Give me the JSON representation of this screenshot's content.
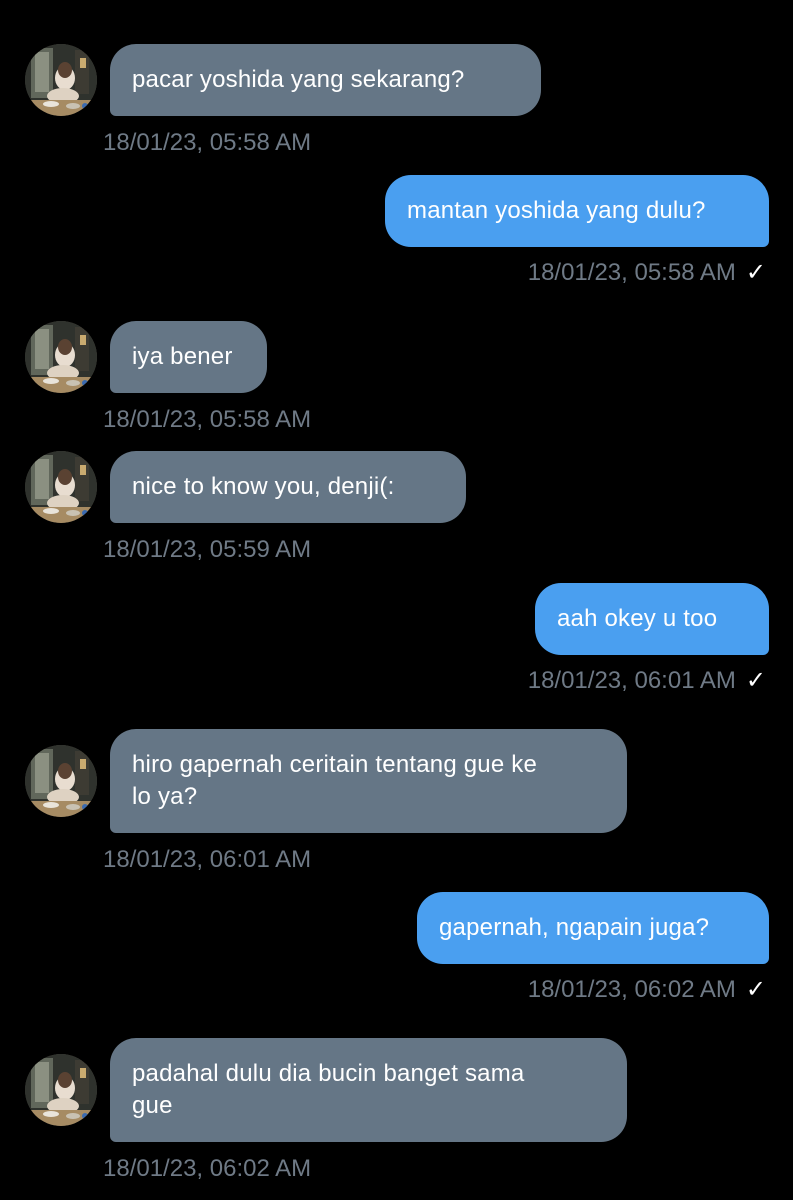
{
  "messages": [
    {
      "side": "in",
      "text": "pacar yoshida yang sekarang?",
      "time": "18/01/23, 05:58 AM"
    },
    {
      "side": "out",
      "text": "mantan yoshida yang dulu?",
      "time": "18/01/23, 05:58 AM",
      "status": "✓"
    },
    {
      "side": "in",
      "text": "iya bener",
      "time": "18/01/23, 05:58 AM"
    },
    {
      "side": "in",
      "text": "nice to know you, denji(:",
      "time": "18/01/23, 05:59 AM"
    },
    {
      "side": "out",
      "text": "aah okey u too",
      "time": "18/01/23, 06:01 AM",
      "status": "✓"
    },
    {
      "side": "in",
      "text": "hiro gapernah ceritain tentang gue ke\nlo ya?",
      "time": "18/01/23, 06:01 AM"
    },
    {
      "side": "out",
      "text": "gapernah, ngapain juga?",
      "time": "18/01/23, 06:02 AM",
      "status": "✓"
    },
    {
      "side": "in",
      "text": "padahal dulu dia bucin banget sama\ngue",
      "time": "18/01/23, 06:02 AM"
    }
  ],
  "colors": {
    "background": "#000000",
    "incoming_bubble": "#657686",
    "outgoing_bubble": "#4a9ff0",
    "timestamp": "#6f7a86",
    "text": "#ffffff"
  },
  "icons": {
    "avatar": "contact-avatar",
    "status": "check-icon"
  }
}
